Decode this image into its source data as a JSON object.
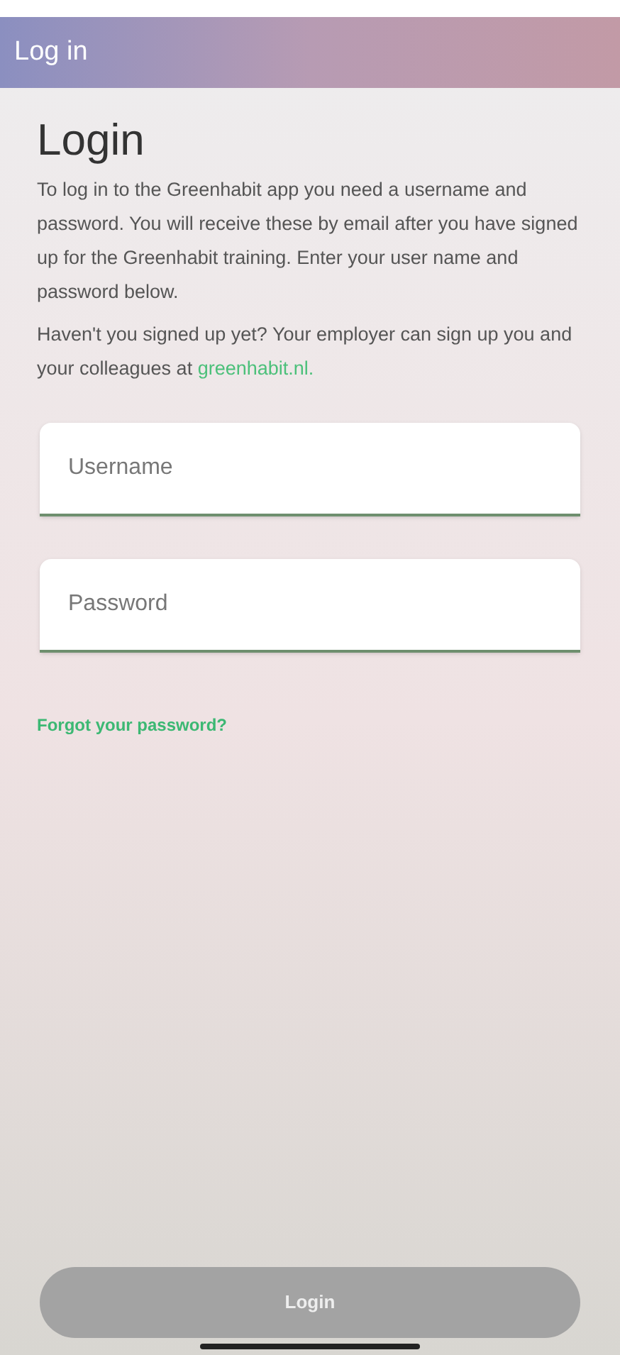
{
  "header": {
    "title": "Log in"
  },
  "heading": "Login",
  "intro": "To log in to the Greenhabit app you need a username and password. You will receive these by email after you have signed up for the Greenhabit training. Enter your user name and password below.",
  "signup_note": {
    "text": "Haven't you signed up yet? Your employer can sign up you and your colleagues at ",
    "link": "greenhabit.nl."
  },
  "fields": [
    {
      "placeholder": "Username"
    },
    {
      "placeholder": "Password"
    }
  ],
  "forgot_link": "Forgot your password?",
  "login_button": {
    "label": "Login",
    "disabled": true
  }
}
